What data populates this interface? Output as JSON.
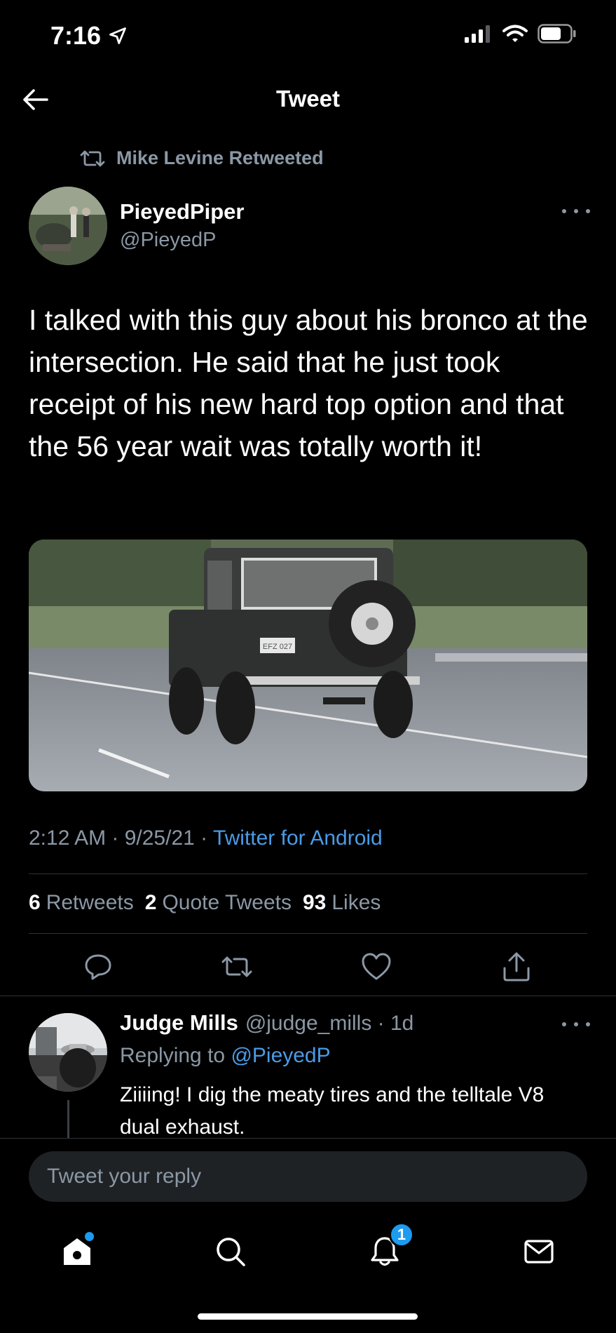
{
  "status_bar": {
    "time": "7:16"
  },
  "header": {
    "title": "Tweet"
  },
  "retweet": {
    "label": "Mike Levine Retweeted"
  },
  "tweet": {
    "author_name": "PieyedPiper",
    "author_handle": "@PieyedP",
    "text": "I talked with this guy about his bronco at the intersection. He said that he just took receipt of his new hard top option and that the 56 year wait was totally worth it!",
    "timestamp": "2:12 AM · 9/25/21 · ",
    "source": "Twitter for Android",
    "license_plate": "EFZ 027",
    "stats": {
      "retweets_count": "6",
      "retweets_label": "Retweets",
      "quotes_count": "2",
      "quotes_label": "Quote Tweets",
      "likes_count": "93",
      "likes_label": "Likes"
    }
  },
  "reply": {
    "name": "Judge Mills",
    "handle": "@judge_mills · 1d",
    "replying_prefix": "Replying to ",
    "replying_to": "@PieyedP",
    "text": "Ziiiing! I dig the meaty tires and the telltale V8 dual exhaust."
  },
  "compose": {
    "placeholder": "Tweet your reply"
  },
  "tab_bar": {
    "notifications_badge": "1"
  },
  "colors": {
    "background": "#000000",
    "accent": "#1d9bf0",
    "link": "#4a9be6",
    "muted": "#8b98a5"
  },
  "icons": [
    "location-arrow-icon",
    "signal-icon",
    "wifi-icon",
    "battery-icon",
    "back-arrow-icon",
    "retweet-icon",
    "more-icon",
    "reply-icon",
    "like-icon",
    "share-icon",
    "home-icon",
    "search-icon",
    "bell-icon",
    "mail-icon"
  ]
}
